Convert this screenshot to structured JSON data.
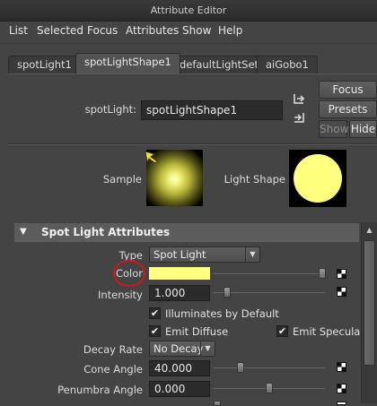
{
  "window": {
    "title": "Attribute Editor"
  },
  "menu": [
    "List",
    "Selected",
    "Focus",
    "Attributes",
    "Show",
    "Help"
  ],
  "tabs": [
    "spotLight1",
    "spotLightShape1",
    "defaultLightSet",
    "aiGobo1"
  ],
  "active_tab": "spotLightShape1",
  "node": {
    "type_label": "spotLight:",
    "name": "spotLightShape1"
  },
  "buttons": {
    "focus": "Focus",
    "presets": "Presets",
    "show": "Show",
    "hide": "Hide"
  },
  "swatches": {
    "sample_label": "Sample",
    "shape_label": "Light Shape"
  },
  "section": {
    "title": "Spot Light Attributes"
  },
  "attributes": {
    "type_label": "Type",
    "type_value": "Spot Light",
    "color_label": "Color",
    "color_value": "#ffff80",
    "intensity_label": "Intensity",
    "intensity_value": "1.000",
    "illum_label": "Illuminates by Default",
    "emit_diffuse_label": "Emit Diffuse",
    "emit_specular_label": "Emit Specular",
    "decay_label": "Decay Rate",
    "decay_value": "No Decay",
    "cone_label": "Cone Angle",
    "cone_value": "40.000",
    "penumbra_label": "Penumbra Angle",
    "penumbra_value": "0.000"
  },
  "checkboxes": {
    "illuminates_by_default": true,
    "emit_diffuse": true,
    "emit_specular": true
  },
  "colors": {
    "annotation_circle": "#d01818",
    "light_color": "#ffff80"
  }
}
